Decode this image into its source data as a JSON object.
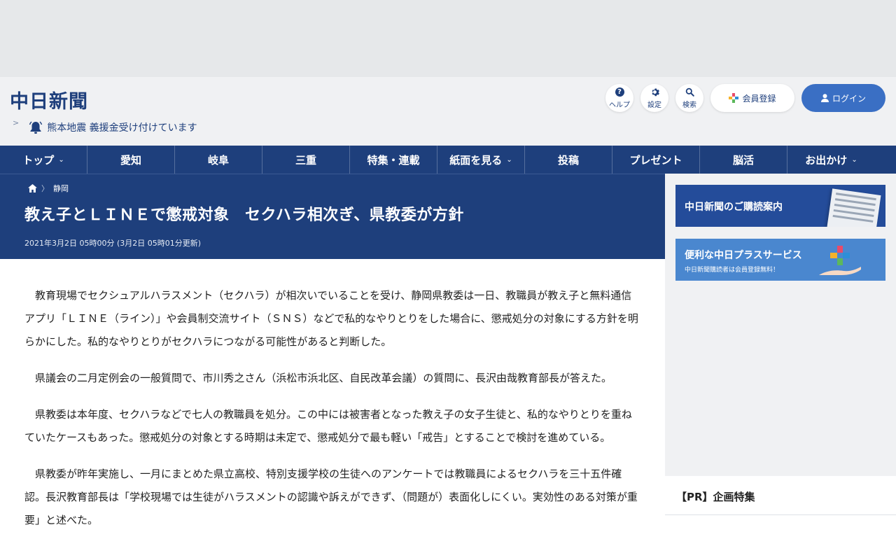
{
  "header": {
    "logo": "中日新聞",
    "help_label": "ヘルプ",
    "settings_label": "設定",
    "search_label": "検索",
    "register_label": "会員登録",
    "login_label": "ログイン",
    "breaking_news": "熊本地震 義援金受け付けています"
  },
  "nav": {
    "items": [
      {
        "label": "トップ",
        "caret": "⌄"
      },
      {
        "label": "愛知"
      },
      {
        "label": "岐阜"
      },
      {
        "label": "三重"
      },
      {
        "label": "特集・連載"
      },
      {
        "label": "紙面を見る",
        "caret": "⌄"
      },
      {
        "label": "投稿"
      },
      {
        "label": "プレゼント"
      },
      {
        "label": "脳活"
      },
      {
        "label": "お出かけ",
        "caret": "⌄"
      }
    ]
  },
  "article": {
    "breadcrumb_category": "静岡",
    "title": "教え子とＬＩＮＥで懲戒対象　セクハラ相次ぎ、県教委が方針",
    "date": "2021年3月2日 05時00分 (3月2日 05時01分更新)",
    "paragraphs": [
      "教育現場でセクシュアルハラスメント（セクハラ）が相次いでいることを受け、静岡県教委は一日、教職員が教え子と無料通信アプリ「ＬＩＮＥ（ライン）」や会員制交流サイト（ＳＮＳ）などで私的なやりとりをした場合に、懲戒処分の対象にする方針を明らかにした。私的なやりとりがセクハラにつながる可能性があると判断した。",
      "県議会の二月定例会の一般質問で、市川秀之さん（浜松市浜北区、自民改革会議）の質問に、長沢由哉教育部長が答えた。",
      "県教委は本年度、セクハラなどで七人の教職員を処分。この中には被害者となった教え子の女子生徒と、私的なやりとりを重ねていたケースもあった。懲戒処分の対象とする時期は未定で、懲戒処分で最も軽い「戒告」とすることで検討を進めている。",
      "県教委が昨年実施し、一月にまとめた県立高校、特別支援学校の生徒へのアンケートでは教職員によるセクハラを三十五件確認。長沢教育部長は「学校現場では生徒がハラスメントの認識や訴えができず、（問題が）表面化しにくい。実効性のある対策が重要」と述べた。"
    ]
  },
  "sidebar": {
    "banner_subscription": "中日新聞のご購読案内",
    "banner_plus_title": "便利な中日プラスサービス",
    "banner_plus_sub": "中日新聞購読者は会員登録無料！",
    "pr_title": "【PR】企画特集"
  },
  "colors": {
    "brand_navy": "#1e3f7c",
    "login_blue": "#3a6fc4",
    "page_bg": "#f0f1f3"
  }
}
